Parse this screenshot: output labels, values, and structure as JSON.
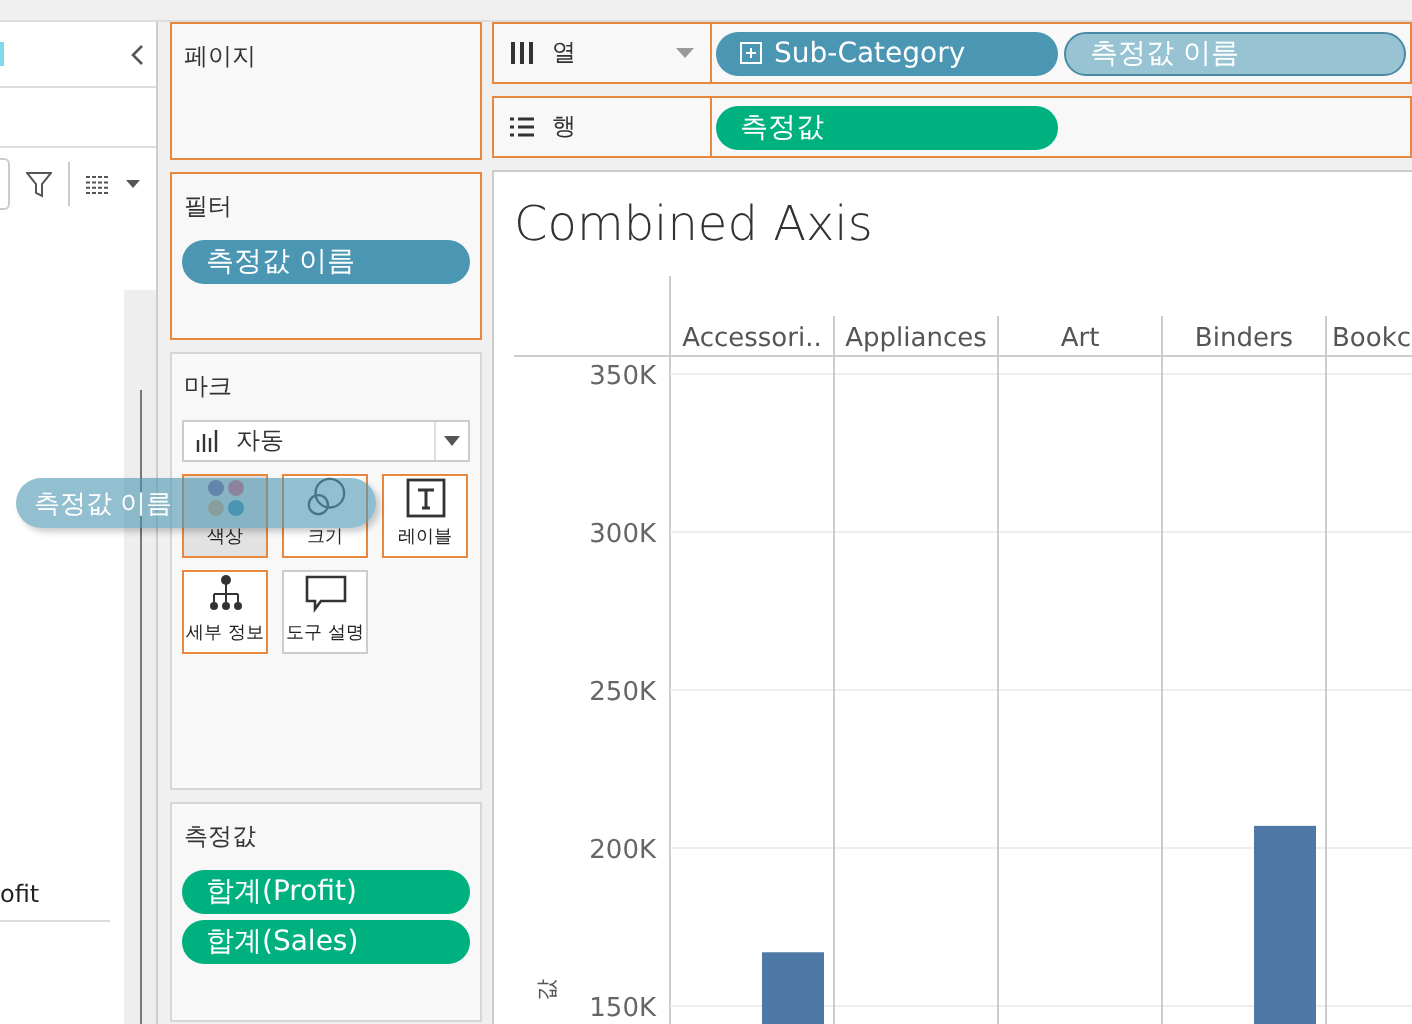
{
  "data_pane": {
    "field_label": "ofit"
  },
  "pages_card": {
    "title": "페이지"
  },
  "filters_card": {
    "title": "필터",
    "pills": [
      {
        "label": "측정값 이름",
        "kind": "dimension"
      }
    ]
  },
  "marks_card": {
    "title": "마크",
    "mark_type": "자동",
    "buttons": [
      {
        "kind": "color",
        "label": "색상",
        "selected": true,
        "highlighted": true
      },
      {
        "kind": "size",
        "label": "크기",
        "selected": false,
        "highlighted": true
      },
      {
        "kind": "label",
        "label": "레이블",
        "selected": false,
        "highlighted": true
      },
      {
        "kind": "detail",
        "label": "세부 정보",
        "selected": false,
        "highlighted": true
      },
      {
        "kind": "tooltip",
        "label": "도구 설명",
        "selected": false,
        "highlighted": false
      }
    ]
  },
  "measures_card": {
    "title": "측정값",
    "pills": [
      {
        "label": "합계(Profit)",
        "kind": "measure"
      },
      {
        "label": "합계(Sales)",
        "kind": "measure"
      }
    ]
  },
  "columns_shelf": {
    "label": "열",
    "pills": [
      {
        "label": "Sub-Category",
        "kind": "dimension",
        "expandable": true
      },
      {
        "label": "측정값 이름",
        "kind": "placeholder",
        "expandable": false
      }
    ]
  },
  "rows_shelf": {
    "label": "행",
    "pills": [
      {
        "label": "측정값",
        "kind": "measure",
        "expandable": false
      }
    ]
  },
  "drag_pill": {
    "label": "측정값 이름"
  },
  "view": {
    "title": "Combined Axis",
    "chart_data": {
      "type": "bar",
      "ylabel": "값",
      "categories": [
        "Accessori..",
        "Appliances",
        "Art",
        "Binders",
        "Bookc"
      ],
      "values": [
        167000,
        null,
        null,
        207000,
        null
      ],
      "ylim": [
        144300,
        381000
      ],
      "grid": true,
      "yticks": [
        {
          "value": 150000,
          "label": "150K"
        },
        {
          "value": 200000,
          "label": "200K"
        },
        {
          "value": 250000,
          "label": "250K"
        },
        {
          "value": 300000,
          "label": "300K"
        },
        {
          "value": 350000,
          "label": "350K"
        }
      ]
    }
  }
}
